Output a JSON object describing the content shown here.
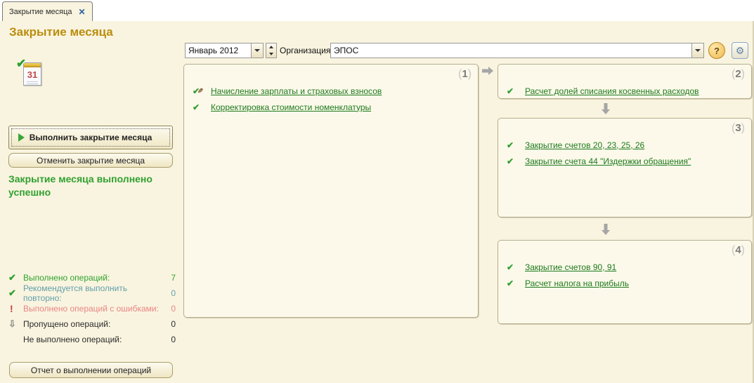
{
  "tab": {
    "label": "Закрытие месяца"
  },
  "page": {
    "title": "Закрытие месяца"
  },
  "toolbar": {
    "period_value": "Январь 2012",
    "org_label": "Организация:",
    "org_value": "ЭПОС"
  },
  "icons": {
    "close": "✕",
    "help": "?",
    "gear": "⚙",
    "check": "✔",
    "pencil": "✎",
    "exclaim": "!",
    "down-arrow": "⇩",
    "calendar_day": "31"
  },
  "left": {
    "execute_button": "Выполнить закрытие месяца",
    "cancel_button": "Отменить закрытие месяца",
    "status": "Закрытие месяца выполнено успешно",
    "report_button": "Отчет о выполнении операций",
    "stats": [
      {
        "icon": "check",
        "label": "Выполнено операций:",
        "value": "7",
        "color": "#2fa32f"
      },
      {
        "icon": "check",
        "label": "Рекомендуется выполнить повторно:",
        "value": "0",
        "color": "#62a0ac"
      },
      {
        "icon": "exclaim",
        "label": "Выполнено операций с ошибками:",
        "value": "0",
        "color": "#e98585"
      },
      {
        "icon": "down-arrow",
        "label": "Пропущено операций:",
        "value": "0",
        "color": "#2b2b2b"
      },
      {
        "icon": "none",
        "label": "Не выполнено операций:",
        "value": "0",
        "color": "#2b2b2b"
      }
    ]
  },
  "panels": [
    {
      "number": "1",
      "items": [
        {
          "icon": "check-pencil",
          "label": "Начисление зарплаты и страховых взносов"
        },
        {
          "icon": "check",
          "label": "Корректировка стоимости номенклатуры"
        }
      ]
    },
    {
      "number": "2",
      "items": [
        {
          "icon": "check",
          "label": "Расчет долей списания косвенных расходов"
        }
      ]
    },
    {
      "number": "3",
      "items": [
        {
          "icon": "check",
          "label": "Закрытие счетов 20, 23, 25, 26"
        },
        {
          "icon": "check",
          "label": "Закрытие счета 44 \"Издержки обращения\""
        }
      ]
    },
    {
      "number": "4",
      "items": [
        {
          "icon": "check",
          "label": "Закрытие счетов 90, 91"
        },
        {
          "icon": "check",
          "label": "Расчет налога на прибыль"
        }
      ]
    }
  ],
  "colors": {
    "page_bg": "#f9f4df",
    "panel_bg": "#fcf9ea",
    "title": "#bb8d0f",
    "link_green": "#1d7a1d",
    "status_green": "#30a030",
    "arrow_gray": "#a6a6a6"
  }
}
